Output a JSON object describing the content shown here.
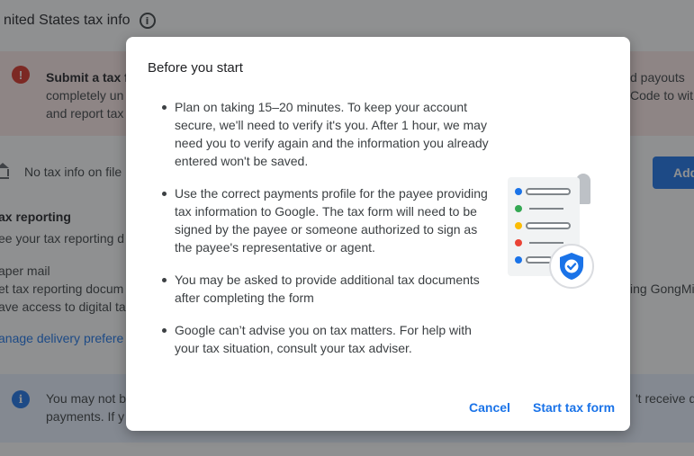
{
  "background": {
    "page_title": "nited States tax info",
    "error_alert": {
      "title": "Submit a tax f",
      "line2": "completely un",
      "line3": "and report tax",
      "right_line1": "d payouts",
      "right_line2": "Code to wit"
    },
    "tax_info_status": "No tax info on file",
    "add_button_label": "Add",
    "tax_reporting_heading": "ax reporting",
    "tax_reporting_desc": "ee your tax reporting d",
    "paper_mail_label": "aper mail",
    "paper_mail_line1": "et tax reporting docum",
    "paper_mail_line2": "ave access to digital ta",
    "paper_mail_right": "ing GongMi",
    "manage_delivery_link": "anage delivery prefere",
    "info_alert": {
      "line1": "You may not b",
      "line2": "payments. If y",
      "right": "'t receive qu"
    }
  },
  "dialog": {
    "title": "Before you start",
    "bullets": [
      "Plan on taking 15–20 minutes. To keep your account secure, we'll need to verify it's you. After 1 hour, we may need you to verify again and the information you already entered won't be saved.",
      "Use the correct payments profile for the payee providing tax information to Google. The tax form will need to be signed by the payee or someone authorized to sign as the payee's representative or agent.",
      "You may be asked to provide additional tax documents after completing the form",
      "Google can’t advise you on tax matters. For help with your tax situation, consult your tax adviser."
    ],
    "cancel_label": "Cancel",
    "start_label": "Start tax form"
  },
  "colors": {
    "accent": "#1a73e8",
    "error": "#d93025",
    "error_bg": "#fce8e6",
    "info_bg": "#e8f0fe",
    "dot_blue": "#1a73e8",
    "dot_green": "#34a853",
    "dot_yellow": "#fbbc04",
    "dot_red": "#ea4335"
  },
  "icons": [
    "info-icon",
    "error-icon",
    "bank-icon",
    "document-checklist-illustration",
    "verified-shield-icon"
  ]
}
